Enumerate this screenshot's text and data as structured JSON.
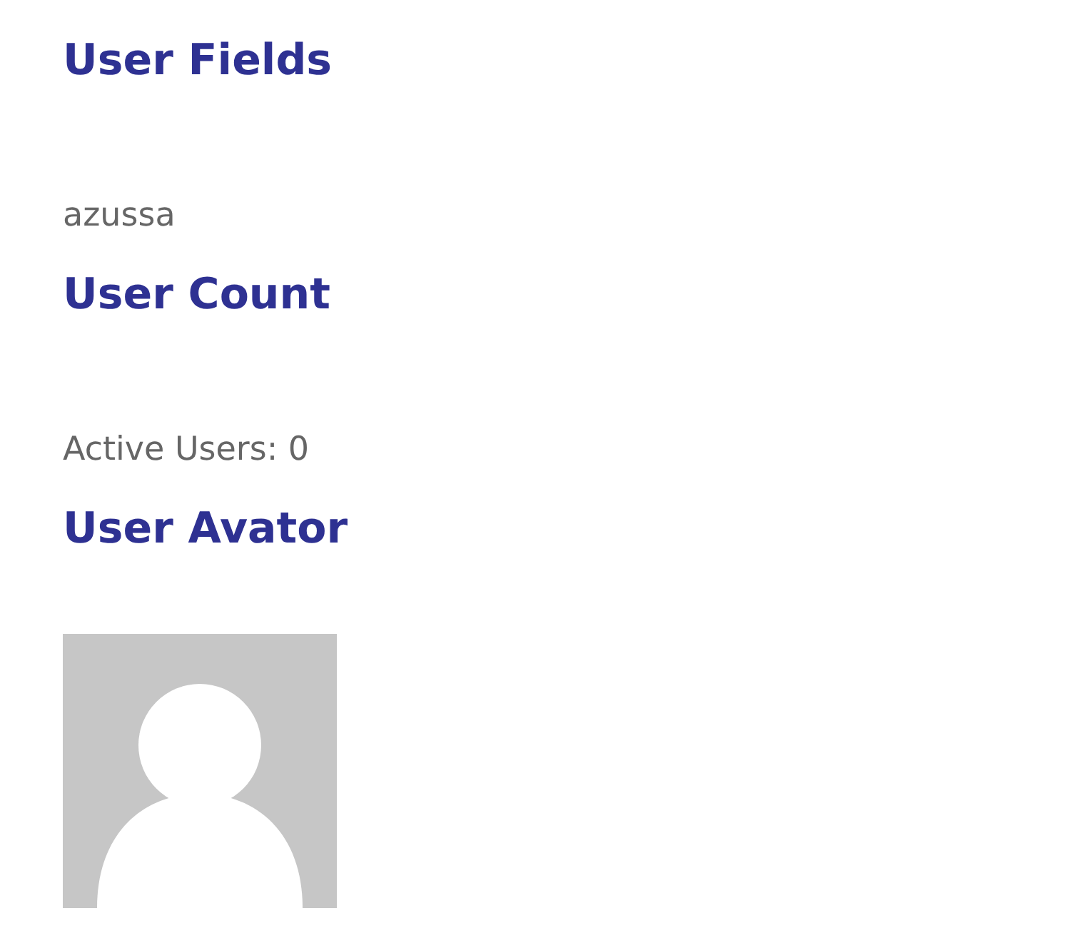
{
  "sections": [
    {
      "heading": "User Fields",
      "kind": "text",
      "text": "azussa"
    },
    {
      "heading": "User Count",
      "kind": "text",
      "text": "Active Users: 0"
    },
    {
      "heading": "User Avator",
      "kind": "avatar"
    }
  ]
}
